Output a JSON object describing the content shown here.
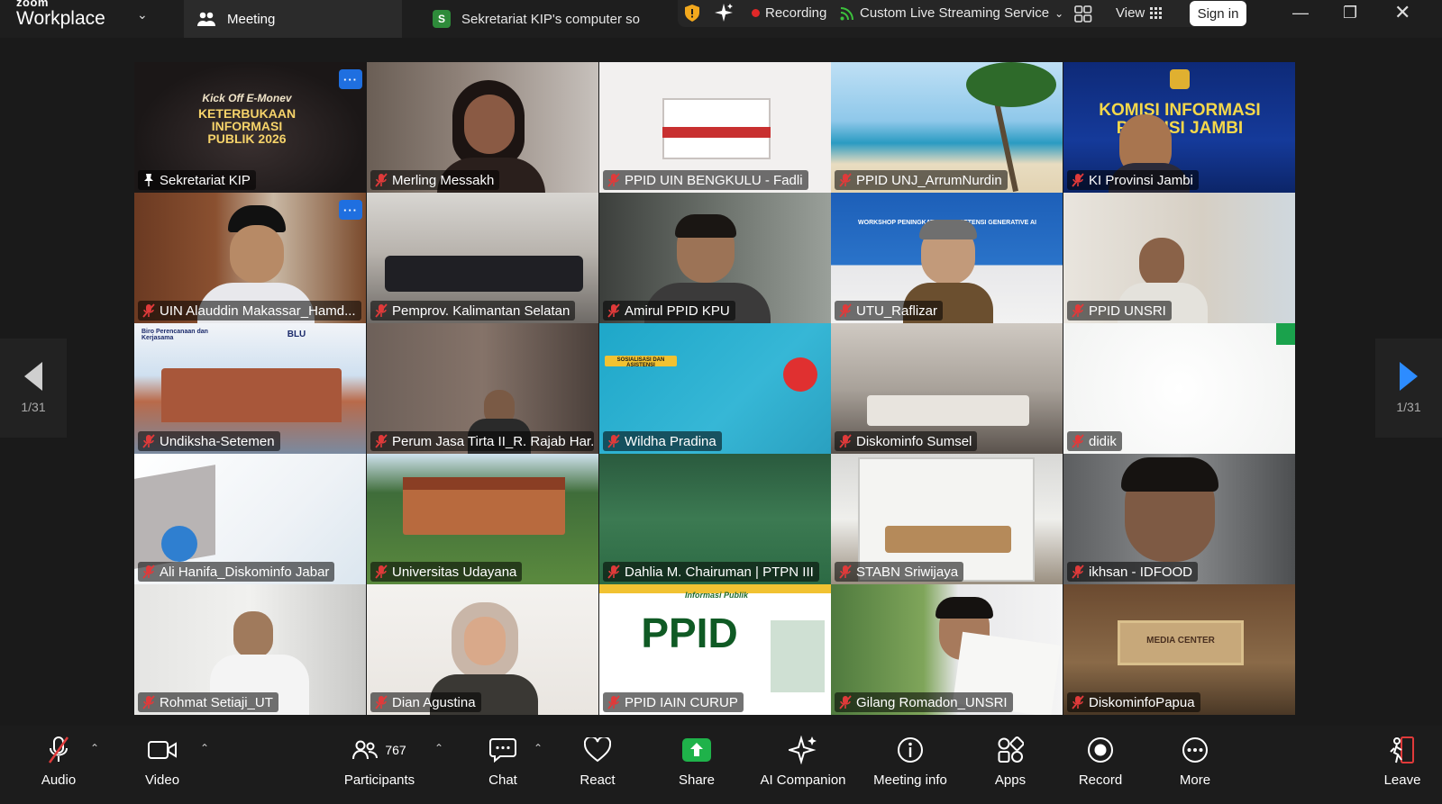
{
  "app": {
    "brand_top": "zoom",
    "brand_bottom": "Workplace"
  },
  "tabs": {
    "meeting": "Meeting",
    "other": "Sekretariat KIP's computer so",
    "other_badge": "S"
  },
  "status": {
    "recording": "Recording",
    "streaming": "Custom Live Streaming Service",
    "view": "View",
    "signin": "Sign in"
  },
  "grid": {
    "tiles": [
      {
        "name": "Sekretariat KIP"
      },
      {
        "name": "Merling Messakh"
      },
      {
        "name": "PPID UIN BENGKULU - Fadli"
      },
      {
        "name": "PPID UNJ_ArrumNurdin"
      },
      {
        "name": "KI Provinsi Jambi"
      },
      {
        "name": "UIN Alauddin Makassar_Hamd..."
      },
      {
        "name": "Pemprov. Kalimantan Selatan"
      },
      {
        "name": "Amirul PPID KPU"
      },
      {
        "name": "UTU_Raflizar"
      },
      {
        "name": "PPID UNSRI"
      },
      {
        "name": "Undiksha-Setemen"
      },
      {
        "name": "Perum Jasa Tirta II_R. Rajab Har..."
      },
      {
        "name": "Wildha Pradina"
      },
      {
        "name": "Diskominfo Sumsel"
      },
      {
        "name": "didik"
      },
      {
        "name": "Ali Hanifa_Diskominfo Jabar"
      },
      {
        "name": "Universitas Udayana"
      },
      {
        "name": "Dahlia M. Chairuman | PTPN III"
      },
      {
        "name": "STABN Sriwijaya"
      },
      {
        "name": "ikhsan - IDFOOD"
      },
      {
        "name": "Rohmat Setiaji_UT"
      },
      {
        "name": "Dian Agustina"
      },
      {
        "name": "PPID IAIN CURUP"
      },
      {
        "name": "Gilang Romadon_UNSRI"
      },
      {
        "name": "DiskominfoPapua"
      }
    ],
    "art": {
      "kip_line1": "Kick Off E-Monev",
      "kip_line2": "KETERBUKAAN",
      "kip_line3": "INFORMASI",
      "kip_line4": "PUBLIK 2026",
      "jambi_line1": "KOMISI INFORMASI",
      "jambi_line2": "PR     ISI JAMBI",
      "ppid_big": "PPID",
      "ppid_sub": "Informasi Publik",
      "media_center": "MEDIA CENTER",
      "blu": "BLU",
      "biro": "Biro Perencanaan dan Kerjasama",
      "sosialisasi": "SOSIALISASI DAN ASISTENSI",
      "workshop": "WORKSHOP PENINGKATAN KOMPETENSI GENERATIVE AI"
    },
    "more_label": "···"
  },
  "pagination": {
    "left": "1/31",
    "right": "1/31"
  },
  "toolbar": {
    "audio": "Audio",
    "video": "Video",
    "participants": "Participants",
    "participants_count": "767",
    "chat": "Chat",
    "react": "React",
    "share": "Share",
    "ai": "AI Companion",
    "meeting_info": "Meeting info",
    "apps": "Apps",
    "record": "Record",
    "more": "More",
    "leave": "Leave"
  },
  "colors": {
    "active_border": "#2fd05a",
    "share_green": "#1fb24a",
    "record_red": "#e02828",
    "leave_red": "#e03a3a"
  }
}
